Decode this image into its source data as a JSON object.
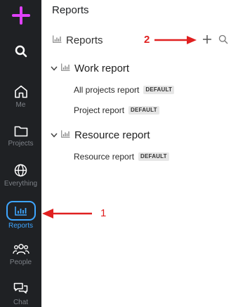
{
  "sidebar": {
    "items": [
      {
        "icon": "plus-icon",
        "label": ""
      },
      {
        "icon": "search-icon",
        "label": ""
      },
      {
        "icon": "home-icon",
        "label": "Me"
      },
      {
        "icon": "folder-icon",
        "label": "Projects"
      },
      {
        "icon": "globe-icon",
        "label": "Everything"
      },
      {
        "icon": "reports-chart-icon",
        "label": "Reports",
        "active": true
      },
      {
        "icon": "people-icon",
        "label": "People"
      },
      {
        "icon": "chat-icon",
        "label": "Chat"
      }
    ]
  },
  "main": {
    "page_title": "Reports",
    "section_title": "Reports",
    "groups": [
      {
        "title": "Work report",
        "items": [
          {
            "name": "All projects report",
            "badge": "DEFAULT"
          },
          {
            "name": "Project report",
            "badge": "DEFAULT"
          }
        ]
      },
      {
        "title": "Resource report",
        "items": [
          {
            "name": "Resource report",
            "badge": "DEFAULT"
          }
        ]
      }
    ]
  },
  "annotations": {
    "step1": "1",
    "step2": "2"
  },
  "colors": {
    "sidebar_bg": "#1f2124",
    "accent": "#3ea6ff",
    "plus": "#e040fb",
    "annotation": "#e02020"
  }
}
